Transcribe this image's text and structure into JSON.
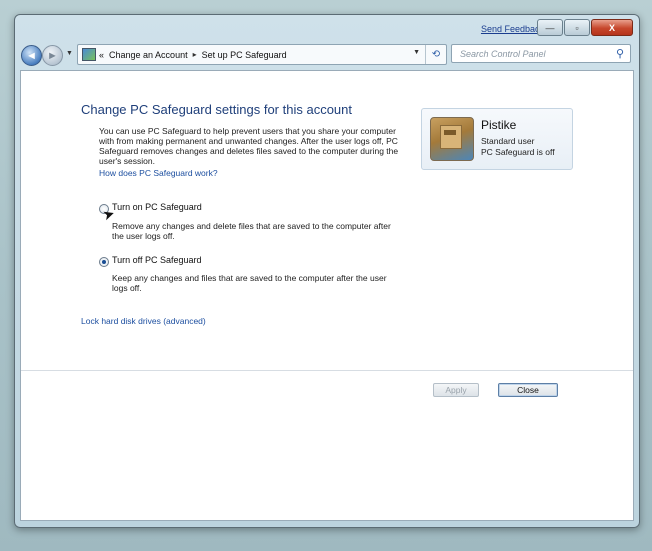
{
  "titlebar": {
    "feedback_label": "Send Feedback",
    "minimize_glyph": "—",
    "maximize_glyph": "▫",
    "close_glyph": "X"
  },
  "nav": {
    "back_glyph": "◄",
    "forward_glyph": "►",
    "history_glyph": "▼"
  },
  "address": {
    "chevrons": "«",
    "crumbs": [
      "Change an Account",
      "Set up PC Safeguard"
    ],
    "separator": "▸",
    "dropdown_glyph": "▼",
    "refresh_glyph": "⟲"
  },
  "search": {
    "placeholder": "Search Control Panel",
    "icon": "search-icon",
    "icon_glyph": "⚲"
  },
  "main": {
    "heading": "Change PC Safeguard settings for this account",
    "description": "You can use PC Safeguard to help prevent users that you share your computer with from making permanent and unwanted changes. After the user logs off, PC Safeguard removes changes and deletes files saved to the computer during the user's session.",
    "how_link": "How does PC Safeguard work?",
    "options": [
      {
        "label": "Turn on PC Safeguard",
        "description": "Remove any changes and delete files that are saved to the computer after the user logs off.",
        "selected": false
      },
      {
        "label": "Turn off PC Safeguard",
        "description": "Keep any changes and  files that are saved to the computer after the user logs off.",
        "selected": true
      }
    ],
    "lock_link": "Lock hard disk drives (advanced)"
  },
  "user": {
    "name": "Pistike",
    "type": "Standard user",
    "status": "PC Safeguard is off"
  },
  "buttons": {
    "apply": "Apply",
    "close": "Close"
  },
  "colors": {
    "link": "#1d4fa0",
    "heading": "#1f3f7a",
    "close_button": "#c7472c"
  }
}
